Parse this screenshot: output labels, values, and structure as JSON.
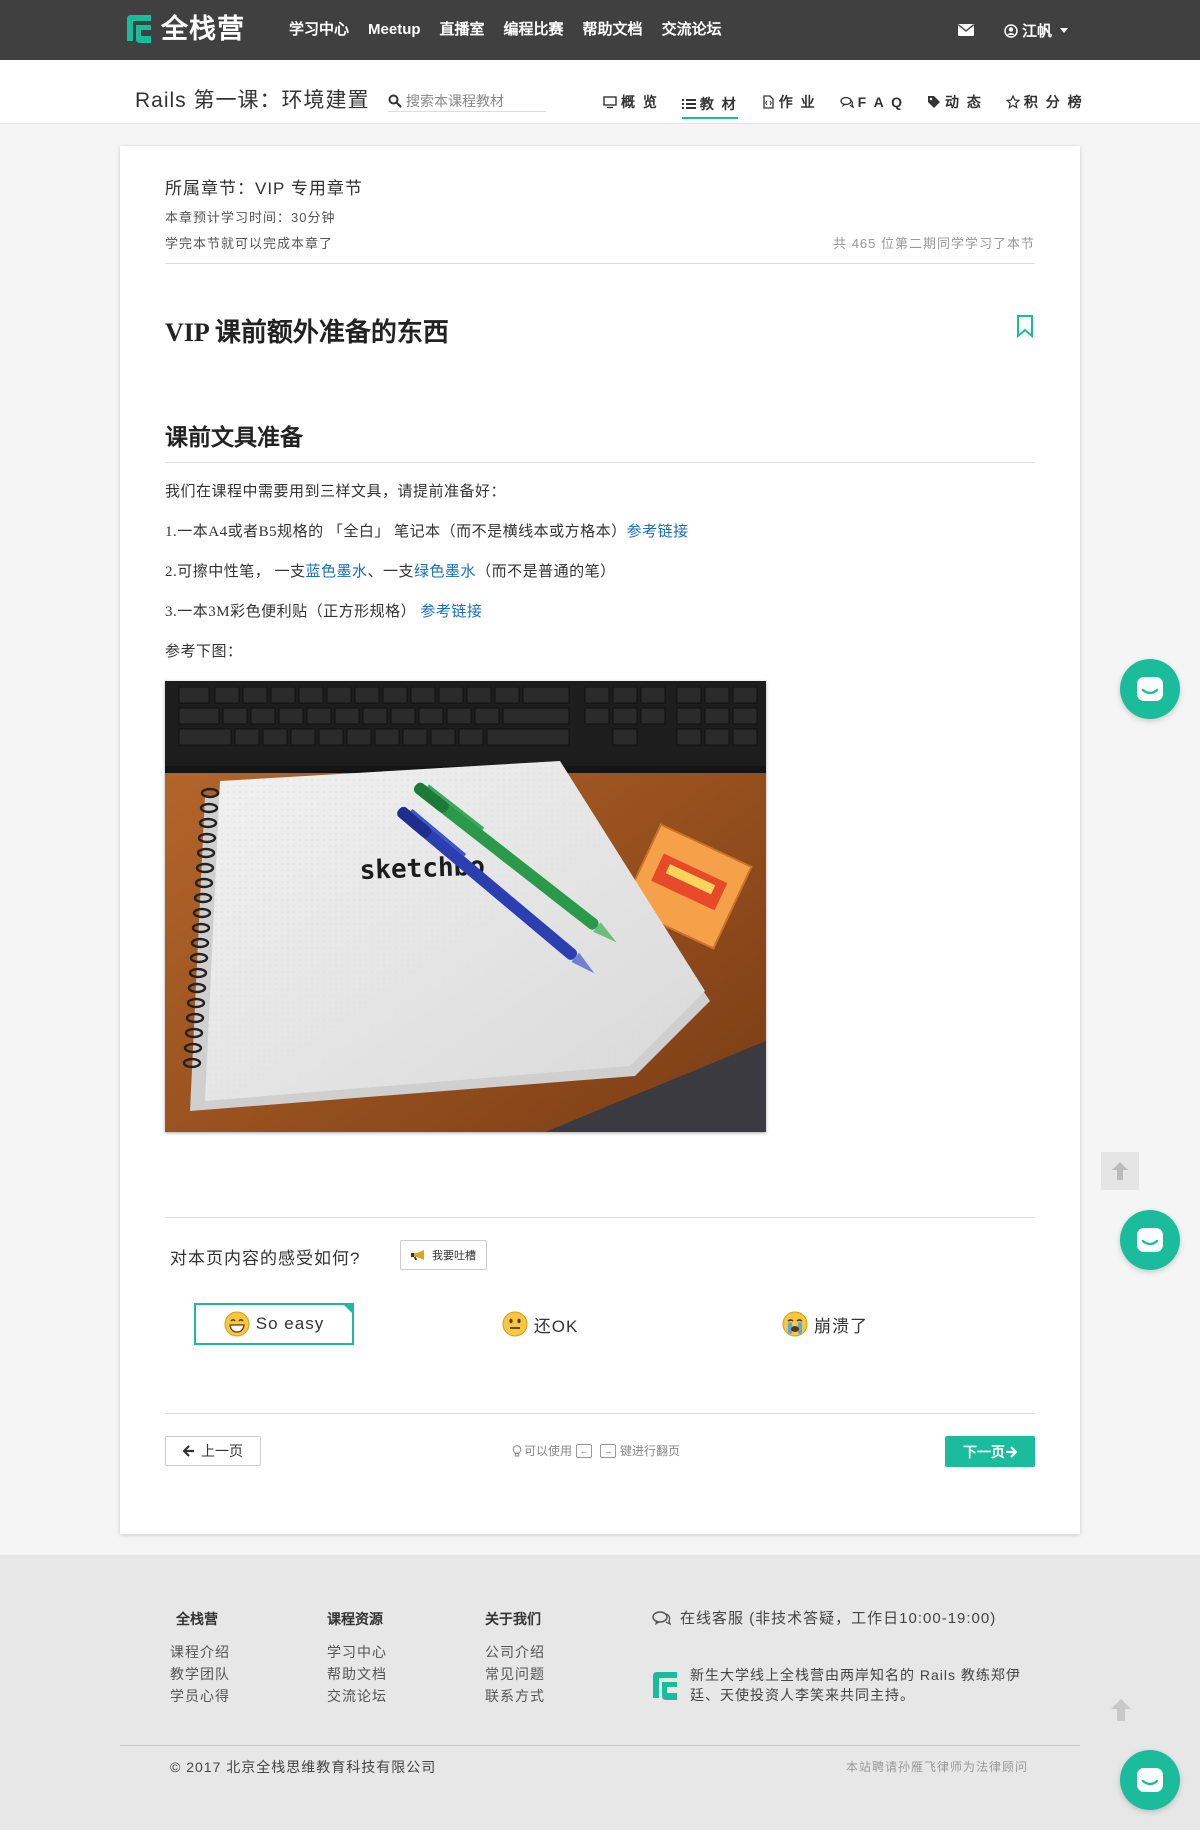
{
  "brand": {
    "name": "全栈营",
    "color": "#1bbc9b"
  },
  "nav": {
    "items": [
      "学习中心",
      "Meetup",
      "直播室",
      "编程比赛",
      "帮助文档",
      "交流论坛"
    ],
    "mail_icon": "envelope-icon",
    "user_name": "江帆"
  },
  "course": {
    "title": "Rails 第一课：环境建置",
    "search_placeholder": "搜索本课程教材",
    "tabs": [
      {
        "label": "概 览",
        "icon": "monitor-icon",
        "active": false
      },
      {
        "label": "教 材",
        "icon": "list-icon",
        "active": true
      },
      {
        "label": "作 业",
        "icon": "file-code-icon",
        "active": false
      },
      {
        "label": "F A Q",
        "icon": "chat-bubbles-icon",
        "active": false
      },
      {
        "label": "动 态",
        "icon": "tag-icon",
        "active": false
      },
      {
        "label": "积 分 榜",
        "icon": "star-icon",
        "active": false
      }
    ]
  },
  "lesson": {
    "chapter": "所属章节：VIP 专用章节",
    "study_time": "本章预计学习时间：30分钟",
    "finish_note": "学完本节就可以完成本章了",
    "learners": "共 465 位第二期同学学习了本节",
    "title": "VIP 课前额外准备的东西",
    "section_title": "课前文具准备",
    "intro": "我们在课程中需要用到三样文具，请提前准备好：",
    "item1_text": "1.一本A4或者B5规格的 「全白」 笔记本（而不是横线本或方格本）",
    "item1_link": "参考链接",
    "item2_prefix": "2.可擦中性笔， 一支",
    "item2_link1": "蓝色墨水",
    "item2_mid": "、一支",
    "item2_link2": "绿色墨水",
    "item2_suffix": "（而不是普通的笔）",
    "item3_text": "3.一本3M彩色便利贴（正方形规格） ",
    "item3_link": "参考链接",
    "see_below": "参考下图：",
    "photo_sketchbook_text": "sketchbo"
  },
  "feedback": {
    "question": "对本页内容的感受如何?",
    "complain_label": "我要吐槽",
    "options": [
      {
        "label": "So easy",
        "emoji": "grinning-face-icon",
        "selected": true
      },
      {
        "label": "还OK",
        "emoji": "neutral-face-icon",
        "selected": false
      },
      {
        "label": "崩溃了",
        "emoji": "crying-face-icon",
        "selected": false
      }
    ]
  },
  "pager": {
    "prev_label": "上一页",
    "hint_pre": "可以使用",
    "key_left": "←",
    "key_right": "→",
    "hint_post": "键进行翻页",
    "next_label": "下一页"
  },
  "footer": {
    "columns": [
      {
        "heading": "全栈营",
        "links": [
          "课程介绍",
          "教学团队",
          "学员心得"
        ]
      },
      {
        "heading": "课程资源",
        "links": [
          "学习中心",
          "帮助文档",
          "交流论坛"
        ]
      },
      {
        "heading": "关于我们",
        "links": [
          "公司介绍",
          "常见问题",
          "联系方式"
        ]
      }
    ],
    "service": "在线客服 (非技术答疑，工作日10:00-19:00)",
    "description": "新生大学线上全栈营由两岸知名的 Rails 教练郑伊廷、天使投资人李笑来共同主持。",
    "copyright": "© 2017 北京全栈思维教育科技有限公司",
    "lawyer": "本站聘请孙雁飞律师为法律顾问"
  }
}
